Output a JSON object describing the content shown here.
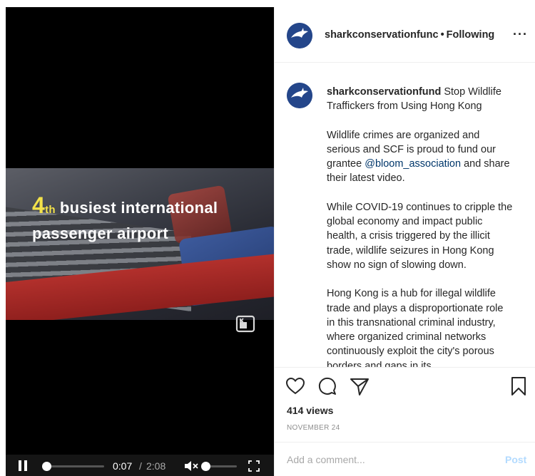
{
  "video": {
    "overlay_number": "4",
    "overlay_ordinal": "th",
    "overlay_line1_rest": "busiest international",
    "overlay_line2": "passenger airport",
    "controls": {
      "current_time": "0:07",
      "separator": "/",
      "total_time": "2:08",
      "progress_fraction": 0.055,
      "volume_fraction": 0.0
    },
    "icons": {
      "pause": "pause-icon",
      "mute": "volume-muted-icon",
      "fullscreen": "fullscreen-icon",
      "pip": "picture-in-picture-icon"
    }
  },
  "header": {
    "username": "sharkconservationfunc",
    "dot": "•",
    "follow_status": "Following",
    "more": "···"
  },
  "caption": {
    "username": "sharkconservationfund",
    "headline": "Stop Wildlife Traffickers from Using Hong Kong",
    "p1_before": "Wildlife crimes are organized and serious and SCF is proud to fund our grantee ",
    "p1_mention": "@bloom_association",
    "p1_after": " and share their latest video.",
    "p2": "While COVID-19 continues to cripple the global economy and impact public health, a crisis triggered by the illicit trade, wildlife seizures in Hong Kong show no sign of slowing down.",
    "p3": "Hong Kong is a hub for illegal wildlife trade and plays a disproportionate role in this transnational criminal industry, where organized criminal networks continuously exploit the city's porous borders and gaps in its"
  },
  "actions": {
    "icons": [
      "heart-icon",
      "comment-icon",
      "share-icon",
      "bookmark-icon"
    ],
    "views": "414 views",
    "date": "NOVEMBER 24"
  },
  "comment": {
    "placeholder": "Add a comment...",
    "post_label": "Post"
  },
  "colors": {
    "accent_yellow": "#f3e24a",
    "link": "#00376b",
    "post_disabled": "#b3dbff",
    "avatar_bg": "#24468a"
  }
}
